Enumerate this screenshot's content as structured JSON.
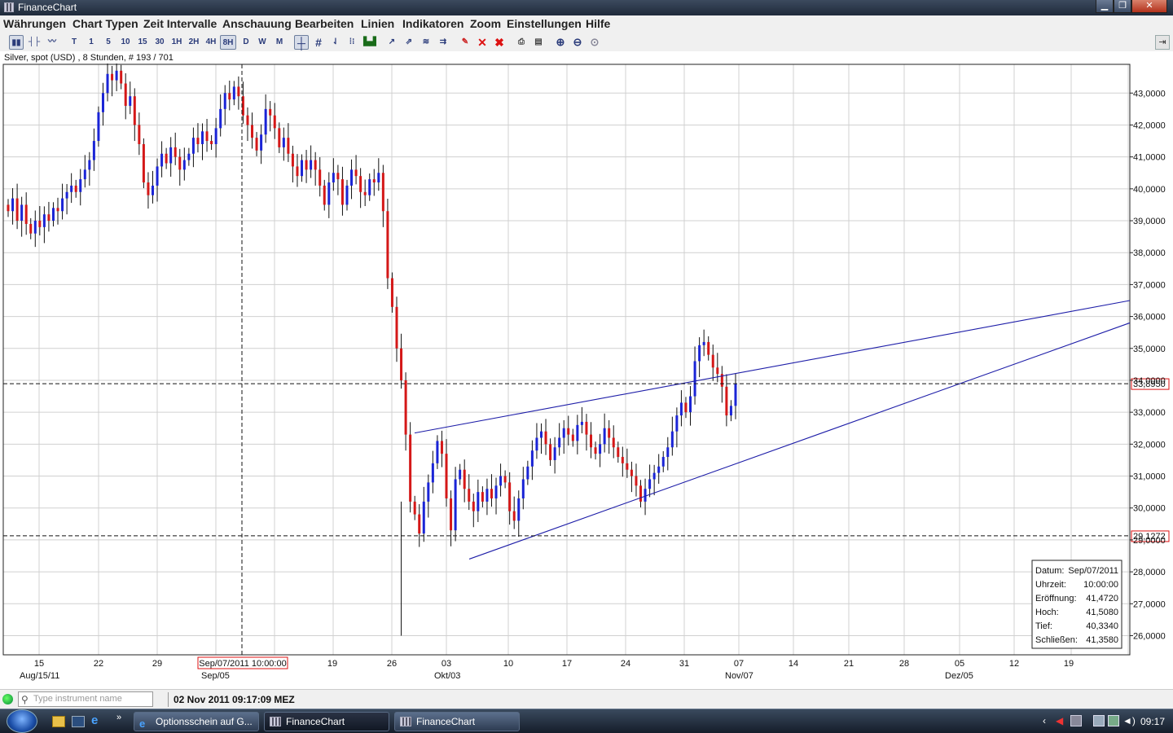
{
  "window": {
    "title": "FinanceChart"
  },
  "menu": [
    "Währungen",
    "Chart Typen",
    "Zeit Intervalle",
    "Anschauung",
    "Bearbeiten",
    "Linien",
    "Indikatoren",
    "Zoom",
    "Einstellungen",
    "Hilfe"
  ],
  "toolbar": {
    "intervals": [
      "T",
      "1",
      "5",
      "10",
      "15",
      "30",
      "1H",
      "2H",
      "4H",
      "8H",
      "D",
      "W",
      "M"
    ],
    "active_interval": "8H"
  },
  "instrument_info": "Silver, spot (USD) , 8 Stunden, # 193 / 701",
  "status": {
    "search_placeholder": "Type instrument name",
    "datetime": "02 Nov 2011 09:17:09 MEZ"
  },
  "taskbar": {
    "tasks": [
      "Optionsschein auf G...",
      "FinanceChart",
      "FinanceChart"
    ],
    "clock": "09:17"
  },
  "colors": {
    "up": "#1a24d6",
    "down": "#d41818",
    "trendline": "#1d1da8",
    "grid": "#d0d0d0"
  },
  "chart_data": {
    "type": "candlestick",
    "instrument": "Silver, spot (USD)",
    "interval": "8 Stunden",
    "ylim": [
      25.4,
      43.9
    ],
    "y_ticks": [
      "43,0000",
      "42,0000",
      "41,0000",
      "40,0000",
      "39,0000",
      "38,0000",
      "37,0000",
      "36,0000",
      "35,0000",
      "34,0000",
      "33,0000",
      "32,0000",
      "31,0000",
      "30,0000",
      "29,0000",
      "28,0000",
      "27,0000",
      "26,0000"
    ],
    "y_tick_values": [
      43,
      42,
      41,
      40,
      39,
      38,
      37,
      36,
      35,
      34,
      33,
      32,
      31,
      30,
      29,
      28,
      27,
      26
    ],
    "x_day_labels": [
      "15",
      "22",
      "29",
      "19",
      "26",
      "03",
      "10",
      "17",
      "24",
      "31",
      "07",
      "14",
      "21",
      "28",
      "05",
      "12",
      "19"
    ],
    "x_month_labels": [
      "Aug/15/11",
      "Sep/05",
      "Okt/03",
      "Nov/07",
      "Dez/05"
    ],
    "price_markers": [
      {
        "label": "33,8950",
        "value": 33.895
      },
      {
        "label": "29,1272",
        "value": 29.1272
      }
    ],
    "crosshair": {
      "date_label": "Sep/07/2011 10:00:00",
      "value": 33.895
    },
    "ohlc_info": [
      {
        "label": "Datum:",
        "value": "Sep/07/2011"
      },
      {
        "label": "Uhrzeit:",
        "value": "10:00:00"
      },
      {
        "label": "Eröffnung:",
        "value": "41,4720"
      },
      {
        "label": "Hoch:",
        "value": "41,5080"
      },
      {
        "label": "Tief:",
        "value": "40,3340"
      },
      {
        "label": "Schließen:",
        "value": "41,3580"
      }
    ],
    "trendlines": [
      {
        "from_bar": 120,
        "from_value": 32.35,
        "to_bar": 330,
        "to_value": 36.5
      },
      {
        "from_bar": 136,
        "from_value": 28.4,
        "to_bar": 330,
        "to_value": 35.8
      }
    ],
    "closes": [
      39.3,
      39.7,
      39.0,
      39.5,
      38.9,
      38.6,
      39.0,
      38.8,
      39.2,
      39.0,
      39.4,
      39.3,
      39.7,
      39.9,
      40.1,
      39.9,
      40.3,
      40.6,
      40.9,
      41.5,
      42.4,
      43.0,
      43.6,
      43.4,
      43.7,
      43.3,
      42.6,
      42.9,
      42.0,
      41.4,
      40.2,
      39.8,
      40.1,
      40.7,
      41.1,
      40.8,
      41.3,
      41.0,
      40.6,
      40.9,
      41.1,
      41.6,
      41.4,
      41.8,
      41.5,
      41.4,
      41.9,
      42.5,
      43.0,
      42.8,
      43.2,
      42.9,
      42.3,
      42.0,
      41.6,
      41.2,
      41.7,
      42.5,
      42.3,
      41.9,
      41.3,
      41.6,
      41.1,
      40.7,
      40.4,
      40.9,
      40.6,
      40.9,
      40.6,
      40.1,
      39.5,
      40.2,
      40.5,
      40.3,
      39.5,
      40.1,
      40.6,
      40.4,
      39.9,
      39.8,
      40.3,
      40.2,
      40.5,
      39.3,
      37.2,
      36.3,
      35.0,
      34.0,
      32.3,
      30.2,
      29.8,
      29.2,
      30.2,
      30.8,
      31.4,
      32.1,
      31.7,
      30.3,
      29.3,
      30.9,
      31.2,
      30.6,
      30.2,
      29.9,
      30.5,
      30.2,
      30.6,
      30.3,
      30.7,
      31.0,
      30.8,
      29.9,
      29.6,
      30.3,
      30.9,
      31.3,
      31.8,
      32.2,
      32.4,
      32.0,
      31.5,
      31.9,
      32.2,
      32.5,
      32.3,
      32.1,
      32.6,
      32.7,
      32.3,
      31.9,
      31.7,
      32.0,
      32.5,
      32.2,
      31.9,
      31.6,
      31.4,
      31.2,
      31.0,
      30.7,
      30.2,
      30.6,
      30.9,
      31.1,
      31.3,
      31.6,
      31.9,
      32.4,
      32.9,
      33.3,
      33.0,
      33.5,
      34.6,
      35.1,
      35.2,
      34.8,
      34.4,
      34.2,
      33.8,
      32.9,
      33.2,
      33.9
    ],
    "bar_count": 330
  }
}
